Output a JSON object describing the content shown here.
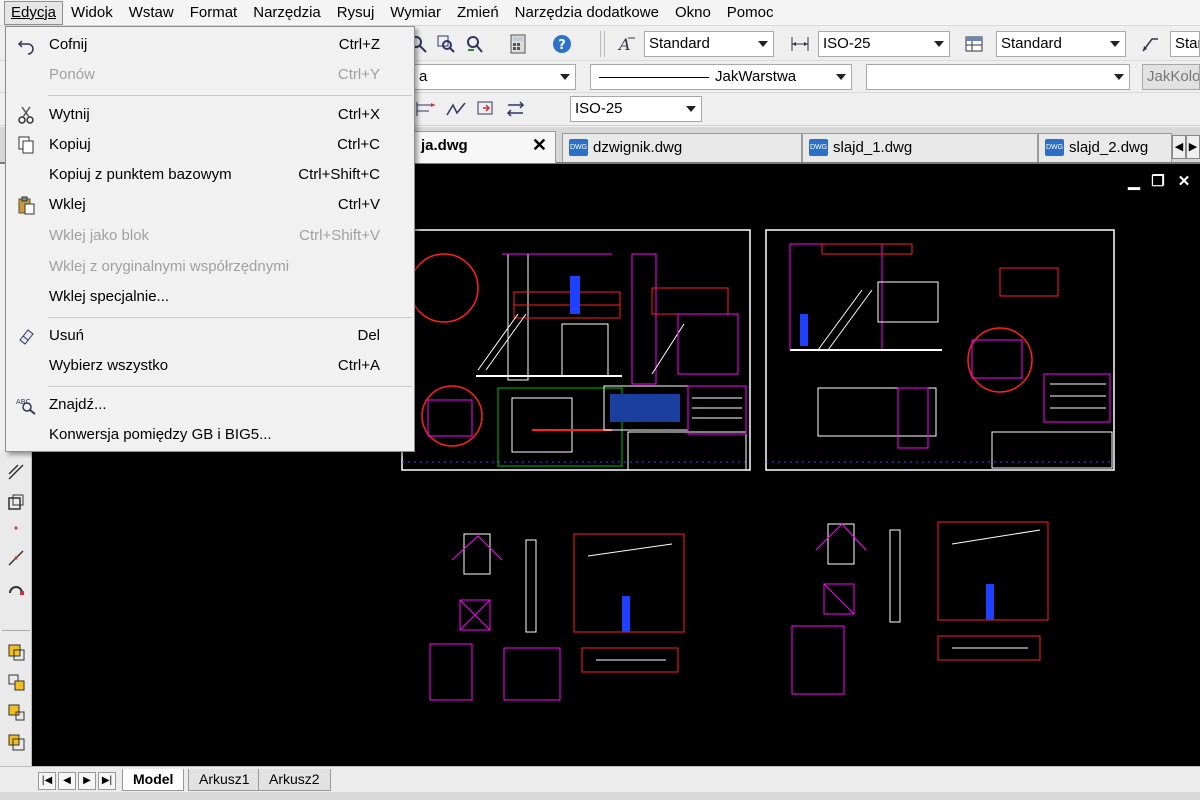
{
  "menubar": {
    "items": [
      "Edycja",
      "Widok",
      "Wstaw",
      "Format",
      "Narzędzia",
      "Rysuj",
      "Wymiar",
      "Zmień",
      "Narzędzia dodatkowe",
      "Okno",
      "Pomoc"
    ]
  },
  "toolbar1": {
    "text_style": "Standard",
    "dim_style": "ISO-25",
    "table_style": "Standard",
    "multileader_style": "Stan"
  },
  "toolbar2": {
    "layer": "a",
    "linetype": "JakWarstwa",
    "color": "",
    "lineweight": "JakKolo"
  },
  "toolbar3": {
    "dim_style": "ISO-25"
  },
  "tabs": [
    {
      "label": "ja.dwg",
      "active": true
    },
    {
      "label": "dzwignik.dwg",
      "active": false
    },
    {
      "label": "slajd_1.dwg",
      "active": false
    },
    {
      "label": "slajd_2.dwg",
      "active": false
    }
  ],
  "tab_close": "✕",
  "layout_tabs": [
    "Model",
    "Arkusz1",
    "Arkusz2"
  ],
  "edit_menu": {
    "items": [
      {
        "label": "Cofnij",
        "shortcut": "Ctrl+Z",
        "enabled": true,
        "icon": "undo-icon"
      },
      {
        "label": "Ponów",
        "shortcut": "Ctrl+Y",
        "enabled": false,
        "icon": ""
      },
      {
        "label": "Wytnij",
        "shortcut": "Ctrl+X",
        "enabled": true,
        "icon": "scissors-icon"
      },
      {
        "label": "Kopiuj",
        "shortcut": "Ctrl+C",
        "enabled": true,
        "icon": "copy-icon"
      },
      {
        "label": "Kopiuj z punktem bazowym",
        "shortcut": "Ctrl+Shift+C",
        "enabled": true,
        "icon": ""
      },
      {
        "label": "Wklej",
        "shortcut": "Ctrl+V",
        "enabled": true,
        "icon": "paste-icon"
      },
      {
        "label": "Wklej jako blok",
        "shortcut": "Ctrl+Shift+V",
        "enabled": false,
        "icon": ""
      },
      {
        "label": "Wklej z oryginalnymi współrzędnymi",
        "shortcut": "",
        "enabled": false,
        "icon": ""
      },
      {
        "label": "Wklej specjalnie...",
        "shortcut": "",
        "enabled": true,
        "icon": ""
      },
      {
        "label": "Usuń",
        "shortcut": "Del",
        "enabled": true,
        "icon": "eraser-icon"
      },
      {
        "label": "Wybierz wszystko",
        "shortcut": "Ctrl+A",
        "enabled": true,
        "icon": ""
      },
      {
        "label": "Znajdź...",
        "shortcut": "",
        "enabled": true,
        "icon": "find-icon"
      },
      {
        "label": "Konwersja pomiędzy GB i BIG5...",
        "shortcut": "",
        "enabled": true,
        "icon": ""
      }
    ]
  },
  "colors": {
    "canvas": "#000000",
    "drawing_white": "#ffffff",
    "drawing_magenta": "#ff00ff",
    "drawing_red": "#ff2020",
    "drawing_blue": "#3050ff",
    "drawing_green": "#00c000"
  }
}
